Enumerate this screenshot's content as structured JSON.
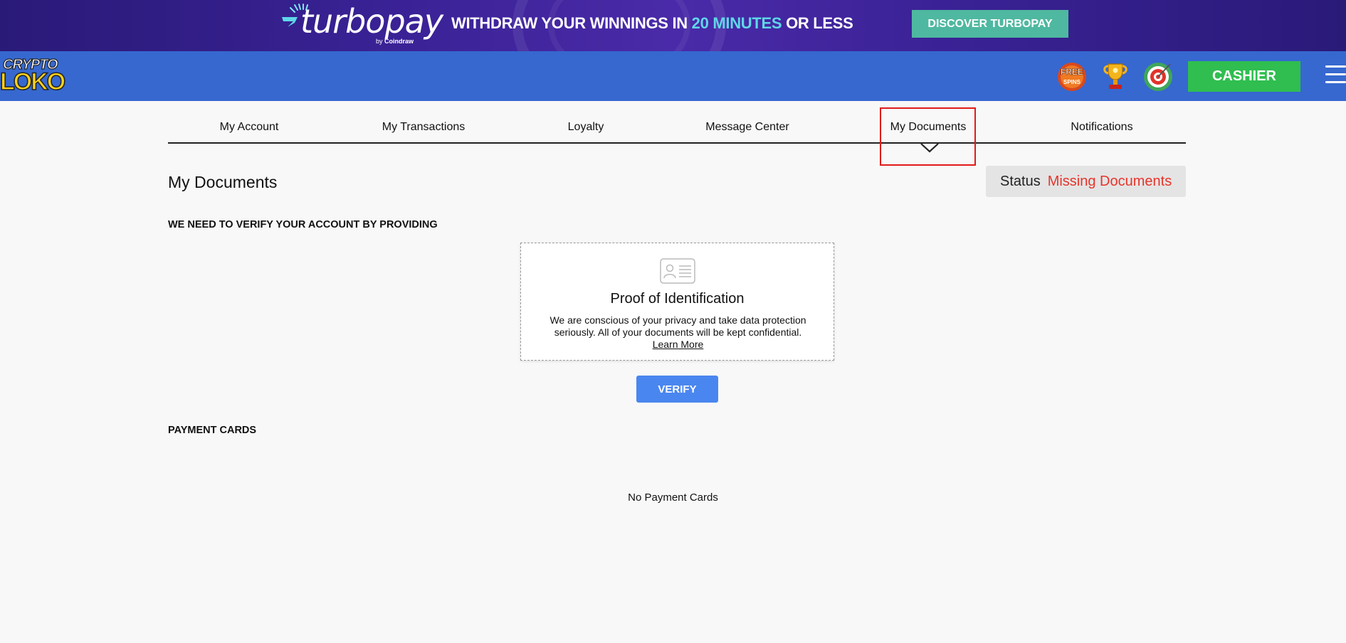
{
  "promo": {
    "brand_name": "turbopay",
    "brand_by": "by",
    "brand_by_company": "Coindraw",
    "text_before": "WITHDRAW YOUR WINNINGS IN ",
    "text_highlight": "20 MINUTES",
    "text_after": " OR LESS",
    "button_label": "DISCOVER TURBOPAY",
    "colors": {
      "highlight": "#5fd7e8",
      "button": "#4fb8a0"
    }
  },
  "header": {
    "logo_top": "CRYPTO",
    "logo_bottom": "LOKO",
    "icons": [
      "free-spins-icon",
      "trophy-icon",
      "target-icon"
    ],
    "free_spins_label_top": "FREE",
    "free_spins_label_bottom": "SPINS",
    "cashier_label": "CASHIER",
    "colors": {
      "bar": "#3668cf",
      "cashier": "#2fbe4f"
    }
  },
  "tabs": [
    {
      "label": "My Account"
    },
    {
      "label": "My Transactions"
    },
    {
      "label": "Loyalty"
    },
    {
      "label": "Message Center"
    },
    {
      "label": "My Documents",
      "active": true
    },
    {
      "label": "Notifications"
    }
  ],
  "page": {
    "title": "My Documents",
    "status_label": "Status",
    "status_value": "Missing Documents",
    "status_color": "#e8342b"
  },
  "verify_section": {
    "title": "WE NEED TO VERIFY YOUR ACCOUNT BY PROVIDING",
    "card": {
      "icon": "id-card-icon",
      "title": "Proof of Identification",
      "description": "We are conscious of your privacy and take data protection seriously. All of your documents will be kept confidential.",
      "link_label": "Learn More"
    },
    "button_label": "VERIFY"
  },
  "payment_cards": {
    "title": "PAYMENT CARDS",
    "empty_text": "No Payment Cards"
  }
}
